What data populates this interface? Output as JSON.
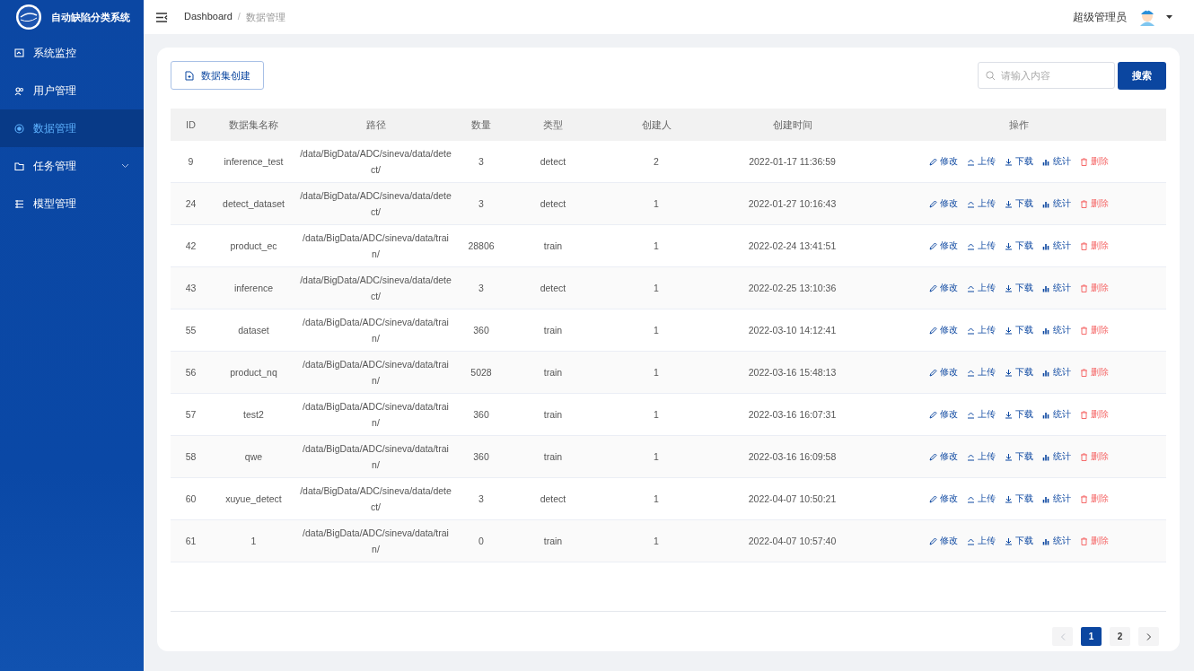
{
  "app": {
    "title": "自动缺陷分类系统"
  },
  "sidebar": {
    "items": [
      {
        "label": "系统监控",
        "selected": false
      },
      {
        "label": "用户管理",
        "selected": false
      },
      {
        "label": "数据管理",
        "selected": true
      },
      {
        "label": "任务管理",
        "selected": false,
        "expanded": false
      },
      {
        "label": "模型管理",
        "selected": false
      }
    ]
  },
  "breadcrumb": {
    "separator": "/",
    "items": [
      {
        "label": "Dashboard"
      },
      {
        "label": "数据管理"
      }
    ]
  },
  "user": {
    "name": "超级管理员"
  },
  "create_button": "数据集创建",
  "search": {
    "placeholder": "请输入内容",
    "button": "搜索"
  },
  "table": {
    "columns": [
      "ID",
      "数据集名称",
      "路径",
      "数量",
      "类型",
      "创建人",
      "创建时间",
      "操作"
    ],
    "rows": [
      {
        "cells": [
          "9",
          "inference_test",
          "/data/BigData/ADC/sineva/data/detect/",
          "3",
          "detect",
          "2",
          "2022-01-17 11:36:59"
        ],
        "actions": [
          {
            "kind": "edit",
            "label": "修改"
          },
          {
            "kind": "upload",
            "label": "上传"
          },
          {
            "kind": "download",
            "label": "下载"
          },
          {
            "kind": "stats",
            "label": "统计"
          },
          {
            "kind": "delete",
            "label": "删除"
          }
        ]
      },
      {
        "cells": [
          "24",
          "detect_dataset",
          "/data/BigData/ADC/sineva/data/detect/",
          "3",
          "detect",
          "1",
          "2022-01-27 10:16:43"
        ],
        "actions": [
          {
            "kind": "edit",
            "label": "修改"
          },
          {
            "kind": "upload",
            "label": "上传"
          },
          {
            "kind": "download",
            "label": "下载"
          },
          {
            "kind": "stats",
            "label": "统计"
          },
          {
            "kind": "delete",
            "label": "删除"
          }
        ]
      },
      {
        "cells": [
          "42",
          "product_ec",
          "/data/BigData/ADC/sineva/data/train/",
          "28806",
          "train",
          "1",
          "2022-02-24 13:41:51"
        ],
        "actions": [
          {
            "kind": "edit",
            "label": "修改"
          },
          {
            "kind": "upload",
            "label": "上传"
          },
          {
            "kind": "download",
            "label": "下载"
          },
          {
            "kind": "stats",
            "label": "统计"
          },
          {
            "kind": "delete",
            "label": "删除"
          }
        ]
      },
      {
        "cells": [
          "43",
          "inference",
          "/data/BigData/ADC/sineva/data/detect/",
          "3",
          "detect",
          "1",
          "2022-02-25 13:10:36"
        ],
        "actions": [
          {
            "kind": "edit",
            "label": "修改"
          },
          {
            "kind": "upload",
            "label": "上传"
          },
          {
            "kind": "download",
            "label": "下载"
          },
          {
            "kind": "stats",
            "label": "统计"
          },
          {
            "kind": "delete",
            "label": "删除"
          }
        ]
      },
      {
        "cells": [
          "55",
          "dataset",
          "/data/BigData/ADC/sineva/data/train/",
          "360",
          "train",
          "1",
          "2022-03-10 14:12:41"
        ],
        "actions": [
          {
            "kind": "edit",
            "label": "修改"
          },
          {
            "kind": "upload",
            "label": "上传"
          },
          {
            "kind": "download",
            "label": "下载"
          },
          {
            "kind": "stats",
            "label": "统计"
          },
          {
            "kind": "delete",
            "label": "删除"
          }
        ]
      },
      {
        "cells": [
          "56",
          "product_nq",
          "/data/BigData/ADC/sineva/data/train/",
          "5028",
          "train",
          "1",
          "2022-03-16 15:48:13"
        ],
        "actions": [
          {
            "kind": "edit",
            "label": "修改"
          },
          {
            "kind": "upload",
            "label": "上传"
          },
          {
            "kind": "download",
            "label": "下载"
          },
          {
            "kind": "stats",
            "label": "统计"
          },
          {
            "kind": "delete",
            "label": "删除"
          }
        ]
      },
      {
        "cells": [
          "57",
          "test2",
          "/data/BigData/ADC/sineva/data/train/",
          "360",
          "train",
          "1",
          "2022-03-16 16:07:31"
        ],
        "actions": [
          {
            "kind": "edit",
            "label": "修改"
          },
          {
            "kind": "upload",
            "label": "上传"
          },
          {
            "kind": "download",
            "label": "下载"
          },
          {
            "kind": "stats",
            "label": "统计"
          },
          {
            "kind": "delete",
            "label": "删除"
          }
        ]
      },
      {
        "cells": [
          "58",
          "qwe",
          "/data/BigData/ADC/sineva/data/train/",
          "360",
          "train",
          "1",
          "2022-03-16 16:09:58"
        ],
        "actions": [
          {
            "kind": "edit",
            "label": "修改"
          },
          {
            "kind": "upload",
            "label": "上传"
          },
          {
            "kind": "download",
            "label": "下载"
          },
          {
            "kind": "stats",
            "label": "统计"
          },
          {
            "kind": "delete",
            "label": "删除"
          }
        ]
      },
      {
        "cells": [
          "60",
          "xuyue_detect",
          "/data/BigData/ADC/sineva/data/detect/",
          "3",
          "detect",
          "1",
          "2022-04-07 10:50:21"
        ],
        "actions": [
          {
            "kind": "edit",
            "label": "修改"
          },
          {
            "kind": "upload",
            "label": "上传"
          },
          {
            "kind": "download",
            "label": "下载"
          },
          {
            "kind": "stats",
            "label": "统计"
          },
          {
            "kind": "delete",
            "label": "删除"
          }
        ]
      },
      {
        "cells": [
          "61",
          "1",
          "/data/BigData/ADC/sineva/data/train/",
          "0",
          "train",
          "1",
          "2022-04-07 10:57:40"
        ],
        "actions": [
          {
            "kind": "edit",
            "label": "修改"
          },
          {
            "kind": "upload",
            "label": "上传"
          },
          {
            "kind": "download",
            "label": "下载"
          },
          {
            "kind": "stats",
            "label": "统计"
          },
          {
            "kind": "delete",
            "label": "删除"
          }
        ]
      }
    ]
  },
  "pagination": {
    "prev_disabled": true,
    "next_disabled": false,
    "pages": [
      {
        "label": "1",
        "selected": true
      },
      {
        "label": "2",
        "selected": false
      }
    ]
  }
}
